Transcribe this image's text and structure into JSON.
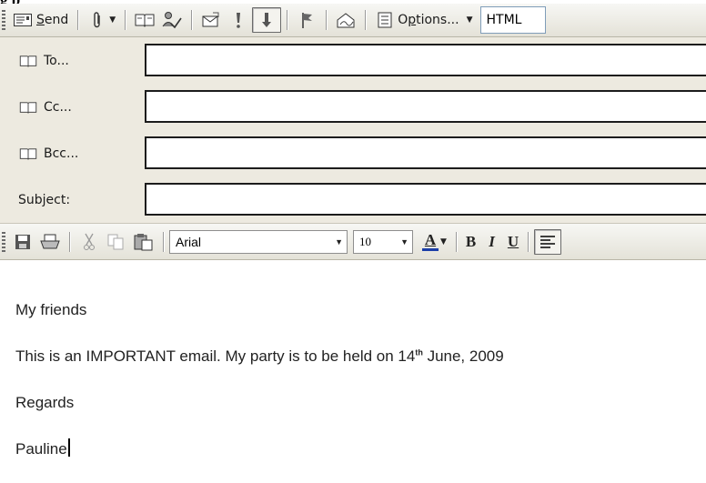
{
  "window": {
    "title_fragment": "g p"
  },
  "toolbar_main": {
    "send_label": "Send",
    "send_mnemonic": "S",
    "options_label": "Options...",
    "options_mnemonic": "p",
    "format_value": "HTML"
  },
  "header": {
    "to_label": "To...",
    "cc_label": "Cc...",
    "bcc_label": "Bcc...",
    "subject_label": "Subject:",
    "to_value": "",
    "cc_value": "",
    "bcc_value": "",
    "subject_value": ""
  },
  "toolbar_format": {
    "font_name": "Arial",
    "font_size": "10",
    "bold_label": "B",
    "italic_label": "I",
    "underline_label": "U",
    "font_color_label": "A"
  },
  "body": {
    "greeting": "My friends",
    "message_before": "This is an IMPORTANT email. My party is to be held on 14",
    "message_superscript": "th",
    "message_after": " June, 2009",
    "closing": "Regards",
    "signature": "Pauline"
  },
  "icons": {
    "send": "send-envelope-icon",
    "attach": "paperclip-icon",
    "address_book": "address-book-icon",
    "check_names": "check-names-icon",
    "envelope": "envelope-icon",
    "importance_high": "exclamation-icon",
    "importance_low": "down-arrow-icon",
    "flag": "flag-icon",
    "signature": "signature-icon",
    "options": "options-icon",
    "save": "floppy-icon",
    "print": "printer-icon",
    "cut": "scissors-icon",
    "copy": "copy-icon",
    "paste": "paste-icon",
    "align_left": "align-left-icon"
  },
  "colors": {
    "font_color_underline": "#1c3fa8",
    "header_bg": "#edeae0",
    "toolbar_bg": "#ebe9e0"
  }
}
